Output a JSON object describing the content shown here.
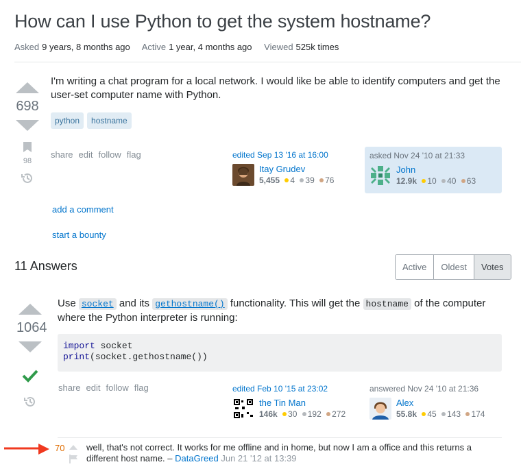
{
  "question": {
    "title": "How can I use Python to get the system hostname?",
    "meta": {
      "asked_label": "Asked",
      "asked_value": "9 years, 8 months ago",
      "active_label": "Active",
      "active_value": "1 year, 4 months ago",
      "viewed_label": "Viewed",
      "viewed_value": "525k times"
    },
    "score": "698",
    "bookmarks": "98",
    "body": "I'm writing a chat program for a local network. I would like be able to identify computers and get the user-set computer name with Python.",
    "tags": [
      "python",
      "hostname"
    ],
    "menu": [
      "share",
      "edit",
      "follow",
      "flag"
    ],
    "editor": {
      "action": "edited Sep 13 '16 at 16:00",
      "name": "Itay Grudev",
      "rep": "5,455",
      "gold": "4",
      "silver": "39",
      "bronze": "76"
    },
    "owner": {
      "action": "asked Nov 24 '10 at 21:33",
      "name": "John",
      "rep": "12.9k",
      "gold": "10",
      "silver": "40",
      "bronze": "63"
    },
    "add_comment": "add a comment",
    "start_bounty": "start a bounty"
  },
  "answers_header": "11 Answers",
  "sort_tabs": [
    "Active",
    "Oldest",
    "Votes"
  ],
  "answer": {
    "score": "1064",
    "text_use": "Use",
    "code_socket": "socket",
    "text_and_its": "and its",
    "code_gethostname": "gethostname()",
    "text_functionality": "functionality. This will get the",
    "code_hostname": "hostname",
    "text_rest": "of the computer where the Python interpreter is running:",
    "code_line1_kw": "import",
    "code_line1_rest": " socket",
    "code_line2_kw": "print",
    "code_line2_rest": "(socket.gethostname())",
    "menu": [
      "share",
      "edit",
      "follow",
      "flag"
    ],
    "editor": {
      "action": "edited Feb 10 '15 at 23:02",
      "name": "the Tin Man",
      "rep": "146k",
      "gold": "30",
      "silver": "192",
      "bronze": "272"
    },
    "owner": {
      "action": "answered Nov 24 '10 at 21:36",
      "name": "Alex",
      "rep": "55.8k",
      "gold": "45",
      "silver": "143",
      "bronze": "174"
    }
  },
  "comment": {
    "score": "70",
    "text": "well, that's not correct. It works for me offline and in home, but now I am a office and this returns a different host name. –",
    "user": "DataGreed",
    "date": "Jun 21 '12 at 13:39"
  },
  "colors": {
    "accent": "#0074cc",
    "accepted": "#2f9a4a",
    "arrow": "#f0391f",
    "comment_score": "#e06c00"
  }
}
